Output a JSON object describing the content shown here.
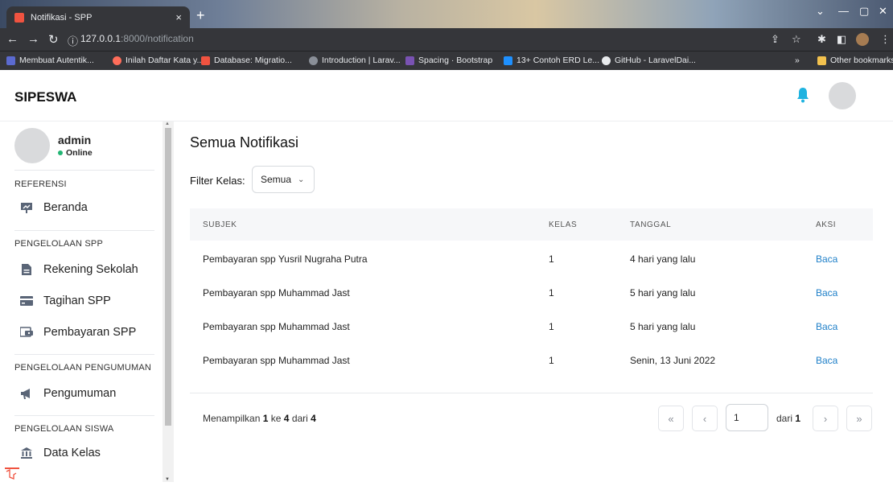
{
  "browser": {
    "tab_title": "Notifikasi - SPP",
    "tab_close": "×",
    "new_tab": "+",
    "url_host": "127.0.0.1",
    "url_rest": ":8000/notification",
    "url_icon": "ⓘ",
    "bookmarks": [
      {
        "label": "Membuat Autentik...",
        "color": "#5b6ad0"
      },
      {
        "label": "Inilah Daftar Kata y...",
        "color": "#ff6d5a"
      },
      {
        "label": "Database: Migratio...",
        "color": "#f05340"
      },
      {
        "label": "Introduction | Larav...",
        "color": "#8a8f98"
      },
      {
        "label": "Spacing · Bootstrap",
        "color": "#7952b3"
      },
      {
        "label": "13+ Contoh ERD Le...",
        "color": "#1e90ff"
      },
      {
        "label": "GitHub - LaravelDai...",
        "color": "#e8eaed"
      }
    ],
    "bookmarks_more": "»",
    "other_bookmarks": "Other bookmarks"
  },
  "topnav": {
    "brand": "SIPESWA",
    "bell_color": "#1fb3e0"
  },
  "sidebar": {
    "user_name": "admin",
    "user_status": "Online",
    "sections": [
      {
        "title": "REFERENSI",
        "items": [
          {
            "label": "Beranda",
            "icon": "presentation-icon"
          }
        ]
      },
      {
        "title": "PENGELOLAAN SPP",
        "items": [
          {
            "label": "Rekening Sekolah",
            "icon": "document-icon"
          },
          {
            "label": "Tagihan SPP",
            "icon": "credit-card-icon"
          },
          {
            "label": "Pembayaran SPP",
            "icon": "wallet-icon"
          }
        ]
      },
      {
        "title": "PENGELOLAAN PENGUMUMAN",
        "items": [
          {
            "label": "Pengumuman",
            "icon": "megaphone-icon"
          }
        ]
      },
      {
        "title": "PENGELOLAAN SISWA",
        "items": [
          {
            "label": "Data Kelas",
            "icon": "bank-icon"
          }
        ]
      }
    ]
  },
  "main": {
    "title": "Semua Notifikasi",
    "filter_label": "Filter Kelas:",
    "filter_value": "Semua",
    "columns": [
      "SUBJEK",
      "KELAS",
      "TANGGAL",
      "AKSI"
    ],
    "rows": [
      {
        "subjek": "Pembayaran spp Yusril Nugraha Putra",
        "kelas": "1",
        "tanggal": "4 hari yang lalu",
        "aksi": "Baca"
      },
      {
        "subjek": "Pembayaran spp Muhammad Jast",
        "kelas": "1",
        "tanggal": "5 hari yang lalu",
        "aksi": "Baca"
      },
      {
        "subjek": "Pembayaran spp Muhammad Jast",
        "kelas": "1",
        "tanggal": "5 hari yang lalu",
        "aksi": "Baca"
      },
      {
        "subjek": "Pembayaran spp Muhammad Jast",
        "kelas": "1",
        "tanggal": "Senin, 13 Juni 2022",
        "aksi": "Baca"
      }
    ],
    "showing_prefix": "Menampilkan",
    "showing_from": "1",
    "showing_to_word": "ke",
    "showing_to": "4",
    "showing_of_word": "dari",
    "showing_total": "4",
    "page_current": "1",
    "page_of_word": "dari",
    "page_total": "1",
    "pager": {
      "first": "«",
      "prev": "‹",
      "next": "›",
      "last": "»"
    }
  }
}
